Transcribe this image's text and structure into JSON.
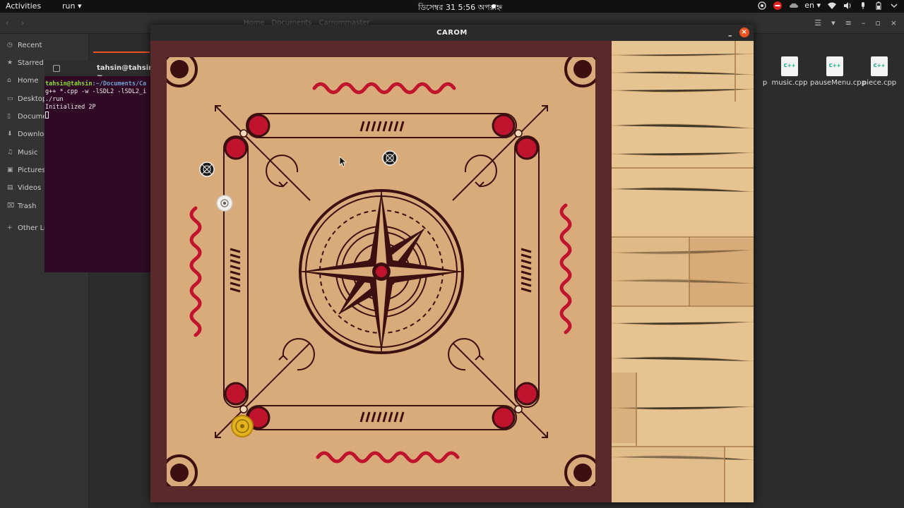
{
  "topbar": {
    "activities": "Activities",
    "app_menu": "run ▾",
    "clock": "ডিসেম্বর 31  5:56 অপরাহ্ন",
    "lang": "en ▾"
  },
  "file_manager": {
    "path": [
      "Home",
      "Documents",
      "Carrommaster"
    ],
    "sidebar": [
      {
        "label": "Recent",
        "icon": "clock-icon"
      },
      {
        "label": "Starred",
        "icon": "star-icon"
      },
      {
        "label": "Home",
        "icon": "home-icon"
      },
      {
        "label": "Desktop",
        "icon": "desktop-icon"
      },
      {
        "label": "Docume",
        "icon": "document-icon"
      },
      {
        "label": "Downloa",
        "icon": "download-icon"
      },
      {
        "label": "Music",
        "icon": "music-icon"
      },
      {
        "label": "Pictures",
        "icon": "picture-icon"
      },
      {
        "label": "Videos",
        "icon": "video-icon"
      },
      {
        "label": "Trash",
        "icon": "trash-icon"
      },
      {
        "label": "Other Lo",
        "icon": "plus-icon"
      }
    ],
    "files": [
      {
        "name": "music.cpp",
        "badge": "C++"
      },
      {
        "name": "pauseMenu.cpp",
        "badge": "C++"
      },
      {
        "name": "piece.cpp",
        "badge": "C++"
      }
    ],
    "partial_file": "p"
  },
  "terminal": {
    "title": "tahsin@tahsin: ~",
    "prompt_user": "tahsin@tahsin",
    "prompt_path": ":~/Documents/Ca",
    "line1": "g++ *.cpp -w -lSDL2 -lSDL2_i",
    "line2": "./run",
    "line3": "Initialized 2P"
  },
  "carom_window": {
    "title": "CAROM",
    "minimize": "–",
    "close": "×"
  },
  "colors": {
    "board": "#d9aa7a",
    "frame": "#5a2a2b",
    "accent_red": "#c0142e",
    "dark_brown": "#3c0f10",
    "wood": "#e6c492"
  }
}
